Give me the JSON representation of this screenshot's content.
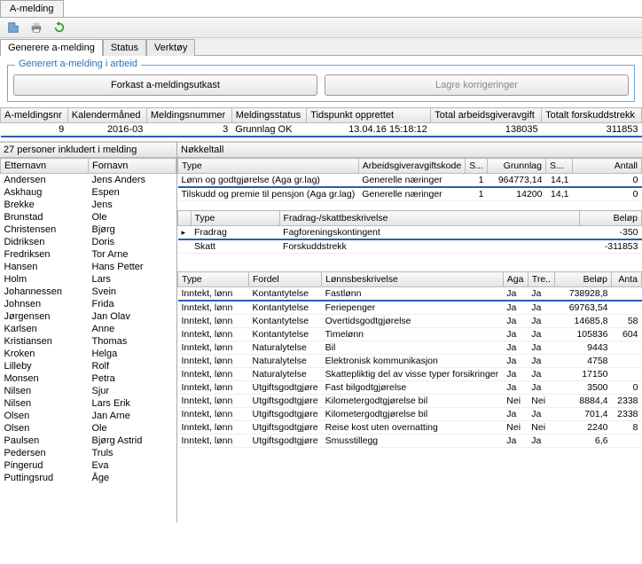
{
  "window_tab": "A-melding",
  "subtabs": [
    "Generere a-melding",
    "Status",
    "Verktøy"
  ],
  "section_title": "Generert a-melding i arbeid",
  "buttons": {
    "discard": "Forkast a-meldingsutkast",
    "save": "Lagre korrigeringer"
  },
  "summary": {
    "headers": [
      "A-meldingsnr",
      "Kalendermåned",
      "Meldingsnummer",
      "Meldingsstatus",
      "Tidspunkt opprettet",
      "Total arbeidsgiveravgift",
      "Totalt forskuddstrekk"
    ],
    "row": [
      "9",
      "2016-03",
      "3",
      "Grunnlag OK",
      "13.04.16 15:18:12",
      "138035",
      "311853"
    ]
  },
  "left_title": "27 personer inkludert i melding",
  "person_headers": [
    "Etternavn",
    "Fornavn"
  ],
  "persons": [
    [
      "Andersen",
      "Jens Anders"
    ],
    [
      "Askhaug",
      "Espen"
    ],
    [
      "Brekke",
      "Jens"
    ],
    [
      "Brunstad",
      "Ole"
    ],
    [
      "Christensen",
      "Bjørg"
    ],
    [
      "Didriksen",
      "Doris"
    ],
    [
      "Fredriksen",
      "Tor Arne"
    ],
    [
      "Hansen",
      "Hans Petter"
    ],
    [
      "Holm",
      "Lars"
    ],
    [
      "Johannessen",
      "Svein"
    ],
    [
      "Johnsen",
      "Frida"
    ],
    [
      "Jørgensen",
      "Jan Olav"
    ],
    [
      "Karlsen",
      "Anne"
    ],
    [
      "Kristiansen",
      "Thomas"
    ],
    [
      "Kroken",
      "Helga"
    ],
    [
      "Lilleby",
      "Rolf"
    ],
    [
      "Monsen",
      "Petra"
    ],
    [
      "Nilsen",
      "Sjur"
    ],
    [
      "Nilsen",
      "Lars Erik"
    ],
    [
      "Olsen",
      "Jan Arne"
    ],
    [
      "Olsen",
      "Ole"
    ],
    [
      "Paulsen",
      "Bjørg Astrid"
    ],
    [
      "Pedersen",
      "Truls"
    ],
    [
      "Pingerud",
      "Eva"
    ],
    [
      "Puttingsrud",
      "Åge"
    ]
  ],
  "right_title": "Nøkkeltall",
  "key_headers": [
    "Type",
    "Arbeidsgiveravgiftskode",
    "S...",
    "Grunnlag",
    "S...",
    "Antall"
  ],
  "key_rows": [
    [
      "Lønn og godtgjørelse (Aga gr.lag)",
      "Generelle næringer",
      "1",
      "964773,14",
      "14,1",
      "0"
    ],
    [
      "Tilskudd og premie til pensjon (Aga gr.lag)",
      "Generelle næringer",
      "1",
      "14200",
      "14,1",
      "0"
    ]
  ],
  "ded_headers": [
    "Type",
    "Fradrag-/skattbeskrivelse",
    "Beløp"
  ],
  "ded_rows": [
    [
      "Fradrag",
      "Fagforeningskontingent",
      "-350"
    ],
    [
      "Skatt",
      "Forskuddstrekk",
      "-311853"
    ]
  ],
  "inc_headers": [
    "Type",
    "Fordel",
    "Lønnsbeskrivelse",
    "Aga",
    "Tre..",
    "Beløp",
    "Anta"
  ],
  "inc_rows": [
    [
      "Inntekt, lønn",
      "Kontantytelse",
      "Fastlønn",
      "Ja",
      "Ja",
      "738928,8",
      ""
    ],
    [
      "Inntekt, lønn",
      "Kontantytelse",
      "Feriepenger",
      "Ja",
      "Ja",
      "69763,54",
      ""
    ],
    [
      "Inntekt, lønn",
      "Kontantytelse",
      "Overtidsgodtgjørelse",
      "Ja",
      "Ja",
      "14685,8",
      "58"
    ],
    [
      "Inntekt, lønn",
      "Kontantytelse",
      "Timelønn",
      "Ja",
      "Ja",
      "105836",
      "604"
    ],
    [
      "Inntekt, lønn",
      "Naturalytelse",
      "Bil",
      "Ja",
      "Ja",
      "9443",
      ""
    ],
    [
      "Inntekt, lønn",
      "Naturalytelse",
      "Elektronisk kommunikasjon",
      "Ja",
      "Ja",
      "4758",
      ""
    ],
    [
      "Inntekt, lønn",
      "Naturalytelse",
      "Skattepliktig del av visse typer forsikringer",
      "Ja",
      "Ja",
      "17150",
      ""
    ],
    [
      "Inntekt, lønn",
      "Utgiftsgodtgjøre",
      "Fast bilgodtgjørelse",
      "Ja",
      "Ja",
      "3500",
      "0"
    ],
    [
      "Inntekt, lønn",
      "Utgiftsgodtgjøre",
      "Kilometergodtgjørelse bil",
      "Nei",
      "Nei",
      "8884,4",
      "2338"
    ],
    [
      "Inntekt, lønn",
      "Utgiftsgodtgjøre",
      "Kilometergodtgjørelse bil",
      "Ja",
      "Ja",
      "701,4",
      "2338"
    ],
    [
      "Inntekt, lønn",
      "Utgiftsgodtgjøre",
      "Reise kost uten overnatting",
      "Nei",
      "Nei",
      "2240",
      "8"
    ],
    [
      "Inntekt, lønn",
      "Utgiftsgodtgjøre",
      "Smusstillegg",
      "Ja",
      "Ja",
      "6,6",
      ""
    ]
  ]
}
